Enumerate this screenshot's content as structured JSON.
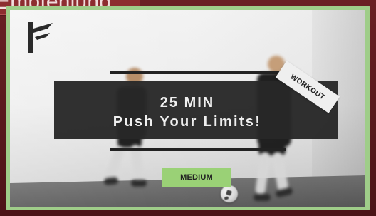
{
  "header": {
    "tag_text": "Empfehlung"
  },
  "card": {
    "overlay_title_line_1": "25 MIN",
    "overlay_title_line_2": "Push Your Limits!",
    "workout_label": "WORKOUT",
    "difficulty_label": "MEDIUM"
  },
  "colors": {
    "outer_background": "#5e1b1e",
    "banner_background": "#8d2d30",
    "card_border": "#9fcd89",
    "overlay_background": "#282828",
    "difficulty_background": "#9ad176",
    "overlay_text": "#efefef",
    "workout_tag_background": "#efefef"
  },
  "icons": {
    "brand": "brand-logo-icon"
  }
}
